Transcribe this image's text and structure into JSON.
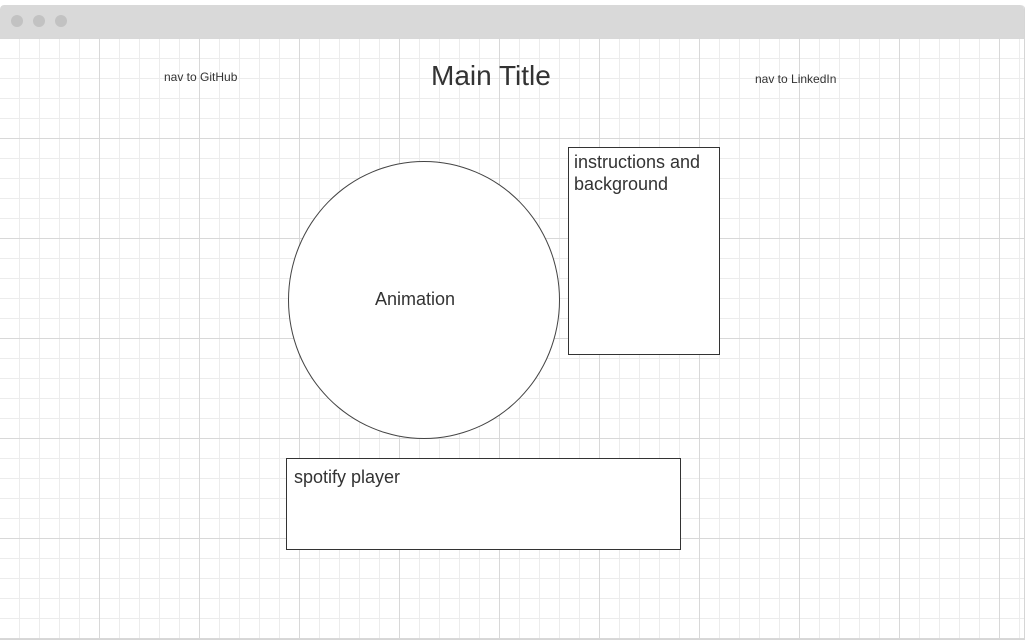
{
  "window": {
    "chrome_dots": [
      "window-dot",
      "window-dot",
      "window-dot"
    ]
  },
  "header": {
    "nav_github": "nav to GitHub",
    "title": "Main Title",
    "nav_linkedin": "nav to LinkedIn"
  },
  "main": {
    "animation_label": "Animation",
    "info_label": "instructions and background",
    "spotify_label": "spotify player"
  },
  "colors": {
    "canvas_bg": "#ffffff",
    "grid_major": "#d8d8d8",
    "grid_minor": "#ececec",
    "titlebar": "#d9d9d9",
    "stroke": "#333333"
  }
}
